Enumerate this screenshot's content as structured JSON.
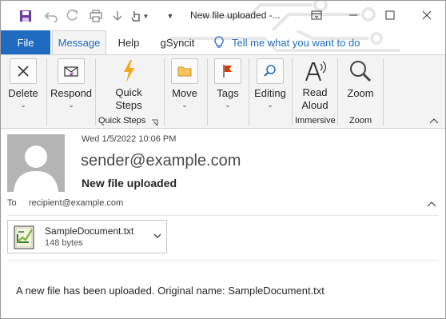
{
  "window": {
    "title": "New file uploaded",
    "title_suffix": " -..."
  },
  "tabs": {
    "file": "File",
    "message": "Message",
    "help": "Help",
    "gsyncit": "gSyncit",
    "tellme": "Tell me what you want to do"
  },
  "ribbon": {
    "delete": "Delete",
    "respond": "Respond",
    "quick_steps_line1": "Quick",
    "quick_steps_line2": "Steps",
    "move": "Move",
    "tags": "Tags",
    "editing": "Editing",
    "read_aloud_line1": "Read",
    "read_aloud_line2": "Aloud",
    "zoom": "Zoom",
    "group_quick_steps": "Quick Steps",
    "group_immersive": "Immersive",
    "group_zoom": "Zoom"
  },
  "message": {
    "date": "Wed 1/5/2022 10:06 PM",
    "sender": "sender@example.com",
    "subject": "New file uploaded",
    "to_label": "To",
    "to": "recipient@example.com",
    "body": "A new file has been uploaded. Original name: SampleDocument.txt"
  },
  "attachment": {
    "name": "SampleDocument.txt",
    "size": "148 bytes"
  },
  "colors": {
    "accent": "#1f6bc1",
    "ribbon_bg": "#f3f3f3",
    "quick_steps_icon": "#f2a81d",
    "tags_flag": "#d83b01"
  },
  "icons": {
    "save": "save-icon",
    "undo": "undo-icon",
    "redo": "redo-icon",
    "delete": "close-x-icon",
    "respond": "reply-envelope-icon",
    "quick_steps": "lightning-icon",
    "move": "folder-icon",
    "tags": "flag-icon",
    "editing": "search-icon",
    "read_aloud": "speaker-a-icon",
    "zoom": "magnifier-icon",
    "attachment": "text-file-icon"
  }
}
